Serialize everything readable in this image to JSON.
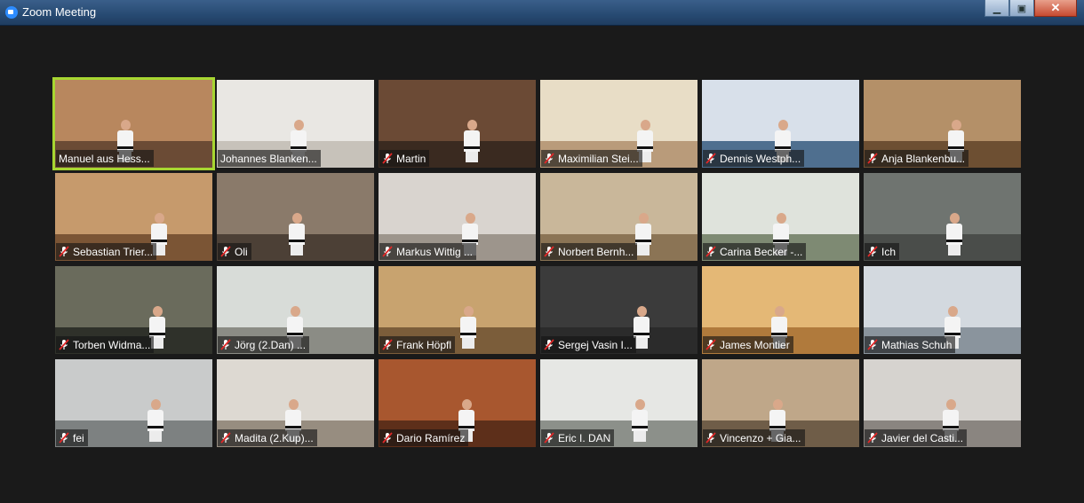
{
  "window": {
    "title": "Zoom Meeting",
    "minimize_icon": "minimize-icon",
    "maximize_icon": "maximize-icon",
    "close_icon": "close-icon"
  },
  "accent_color": "#a7d631",
  "muted_color": "#e02828",
  "participants": [
    {
      "name": "Manuel aus Hess...",
      "muted": false,
      "active": true,
      "wall": "#b8875e",
      "floor": "#6b4b35"
    },
    {
      "name": "Johannes Blanken...",
      "muted": false,
      "active": false,
      "wall": "#e9e7e3",
      "floor": "#c7c2ba"
    },
    {
      "name": "Martin",
      "muted": true,
      "active": false,
      "wall": "#6b4a35",
      "floor": "#3a2a20"
    },
    {
      "name": "Maximilian Stei...",
      "muted": true,
      "active": false,
      "wall": "#e8ddc6",
      "floor": "#b99b7a"
    },
    {
      "name": "Dennis Westph...",
      "muted": true,
      "active": false,
      "wall": "#d8e0ea",
      "floor": "#4f6f8f"
    },
    {
      "name": "Anja Blankenbu...",
      "muted": true,
      "active": false,
      "wall": "#b49068",
      "floor": "#6d4f32"
    },
    {
      "name": "Sebastian Trier...",
      "muted": true,
      "active": false,
      "wall": "#c69a6c",
      "floor": "#7b5535"
    },
    {
      "name": "Oli",
      "muted": true,
      "active": false,
      "wall": "#8a7a6a",
      "floor": "#4c4036"
    },
    {
      "name": "Markus Wittig ...",
      "muted": true,
      "active": false,
      "wall": "#d9d4cf",
      "floor": "#9d958c"
    },
    {
      "name": "Norbert Bernh...",
      "muted": true,
      "active": false,
      "wall": "#c9b79a",
      "floor": "#8b7455"
    },
    {
      "name": "Carina Becker -...",
      "muted": true,
      "active": false,
      "wall": "#dfe3dc",
      "floor": "#7e8a73"
    },
    {
      "name": "Ich",
      "muted": true,
      "active": false,
      "wall": "#6f7470",
      "floor": "#4a4d4a"
    },
    {
      "name": "Torben Widma...",
      "muted": true,
      "active": false,
      "wall": "#6a6b5c",
      "floor": "#2f312a"
    },
    {
      "name": "Jörg (2.Dan) ...",
      "muted": true,
      "active": false,
      "wall": "#d8dcd8",
      "floor": "#8b8c85"
    },
    {
      "name": "Frank Höpfl",
      "muted": true,
      "active": false,
      "wall": "#c8a36f",
      "floor": "#7b5d3a"
    },
    {
      "name": "Sergej Vasin  I...",
      "muted": true,
      "active": false,
      "wall": "#3b3b3b",
      "floor": "#2b2b2b"
    },
    {
      "name": "James Montier",
      "muted": true,
      "active": false,
      "wall": "#e4b876",
      "floor": "#b07a3c"
    },
    {
      "name": "Mathias Schuh",
      "muted": true,
      "active": false,
      "wall": "#d3d9df",
      "floor": "#8a949d"
    },
    {
      "name": "fei",
      "muted": true,
      "active": false,
      "wall": "#c9cbcb",
      "floor": "#7d8181"
    },
    {
      "name": "Madita (2.Kup)...",
      "muted": true,
      "active": false,
      "wall": "#ddd9d2",
      "floor": "#978d80"
    },
    {
      "name": "Dario Ramírez",
      "muted": true,
      "active": false,
      "wall": "#a8572f",
      "floor": "#5d2f1a"
    },
    {
      "name": "Eric I. DAN",
      "muted": true,
      "active": false,
      "wall": "#e6e7e4",
      "floor": "#8c908a"
    },
    {
      "name": "Vincenzo + Gia...",
      "muted": true,
      "active": false,
      "wall": "#bfa789",
      "floor": "#6f5d48"
    },
    {
      "name": "Javier del Casti...",
      "muted": true,
      "active": false,
      "wall": "#d6d3cf",
      "floor": "#8a8580"
    }
  ]
}
